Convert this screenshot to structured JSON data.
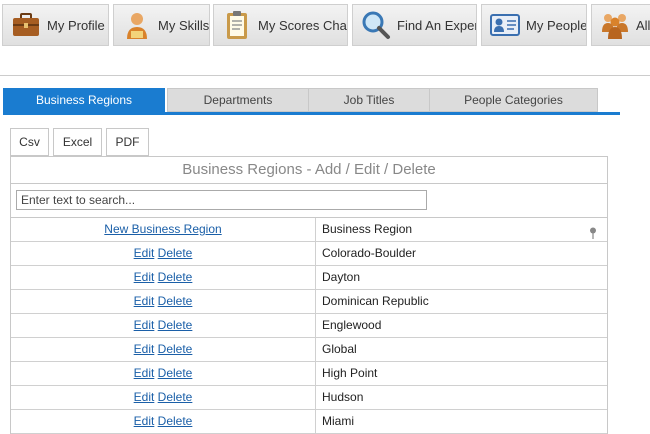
{
  "nav": [
    {
      "label": "My Profile",
      "icon": "briefcase-icon"
    },
    {
      "label": "My Skills",
      "icon": "user-skills-icon"
    },
    {
      "label": "My Scores Chart",
      "icon": "clipboard-icon"
    },
    {
      "label": "Find An Expert",
      "icon": "magnifier-icon"
    },
    {
      "label": "My People",
      "icon": "contact-card-icon"
    },
    {
      "label": "All",
      "icon": "people-group-icon"
    }
  ],
  "tabs": [
    "Business Regions",
    "Departments",
    "Job Titles",
    "People Categories"
  ],
  "active_tab": "Business Regions",
  "exports": [
    "Csv",
    "Excel",
    "PDF"
  ],
  "grid": {
    "title": "Business Regions - Add / Edit / Delete",
    "search_placeholder": "Enter text to search...",
    "new_link": "New Business Region",
    "column_header": "Business Region",
    "edit_label": "Edit",
    "delete_label": "Delete",
    "rows": [
      "Colorado-Boulder",
      "Dayton",
      "Dominican Republic",
      "Englewood",
      "Global",
      "High Point",
      "Hudson",
      "Miami"
    ]
  },
  "colors": {
    "accent": "#1a7cd0",
    "link": "#1a5fa8"
  }
}
